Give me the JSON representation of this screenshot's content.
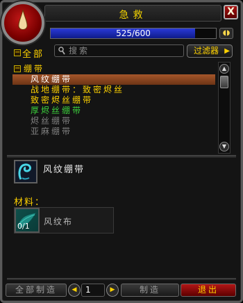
{
  "window": {
    "title": "急救",
    "close_label": "X"
  },
  "progress": {
    "text": "525/600",
    "fraction": 0.875
  },
  "header": {
    "all_label": "全部",
    "search_placeholder": "搜索",
    "filter_label": "过滤器",
    "filter_arrow": "▶",
    "expand_symbol": "−"
  },
  "list": {
    "category": "绷带",
    "recipes": [
      {
        "label": "风纹绷带",
        "color": "#ffffff",
        "selected": true
      },
      {
        "label": "战地绷带：致密烬丝",
        "color": "#ffd200",
        "selected": false
      },
      {
        "label": "致密烬丝绷带",
        "color": "#ffd200",
        "selected": false
      },
      {
        "label": "厚烬丝绷带",
        "color": "#3ccf3c",
        "selected": false
      },
      {
        "label": "烬丝绷带",
        "color": "#808080",
        "selected": false
      },
      {
        "label": "亚麻绷带",
        "color": "#808080",
        "selected": false
      }
    ]
  },
  "detail": {
    "item_name": "风纹绷带",
    "materials_label": "材料：",
    "reagent": {
      "name": "风纹布",
      "count": "0/1"
    }
  },
  "bottom": {
    "craft_all_label": "全部制造",
    "quantity": "1",
    "craft_label": "制造",
    "exit_label": "退出",
    "dec_symbol": "◀",
    "inc_symbol": "▶"
  },
  "icons": {
    "portrait": "blood-drop-icon",
    "item": "bandage-icon",
    "reagent": "cloth-icon",
    "search": "magnifier-icon",
    "chat": "chat-bubble-icon"
  }
}
